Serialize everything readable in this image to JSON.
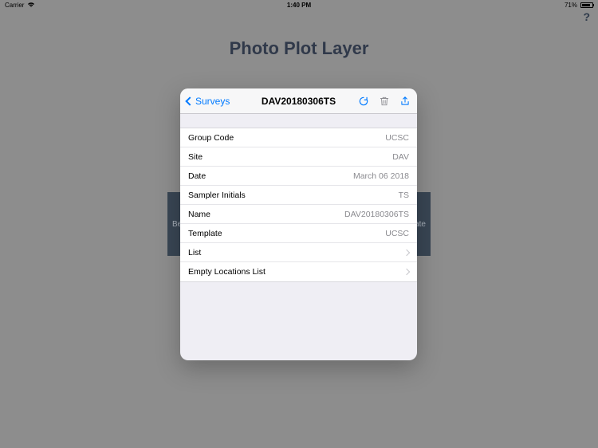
{
  "status": {
    "carrier": "Carrier",
    "time": "1:40 PM",
    "battery_pct": "71%"
  },
  "help": "?",
  "page_title": "Photo Plot Layer",
  "bg": {
    "left": "Be",
    "right": "ate"
  },
  "nav": {
    "back_label": "Surveys",
    "title": "DAV20180306TS"
  },
  "fields": {
    "group_code": {
      "label": "Group Code",
      "value": "UCSC"
    },
    "site": {
      "label": "Site",
      "value": "DAV"
    },
    "date": {
      "label": "Date",
      "value": "March 06 2018"
    },
    "sampler": {
      "label": "Sampler Initials",
      "value": "TS"
    },
    "name": {
      "label": "Name",
      "value": "DAV20180306TS"
    },
    "template": {
      "label": "Template",
      "value": "UCSC"
    },
    "list": {
      "label": "List"
    },
    "empty": {
      "label": "Empty Locations List"
    }
  }
}
